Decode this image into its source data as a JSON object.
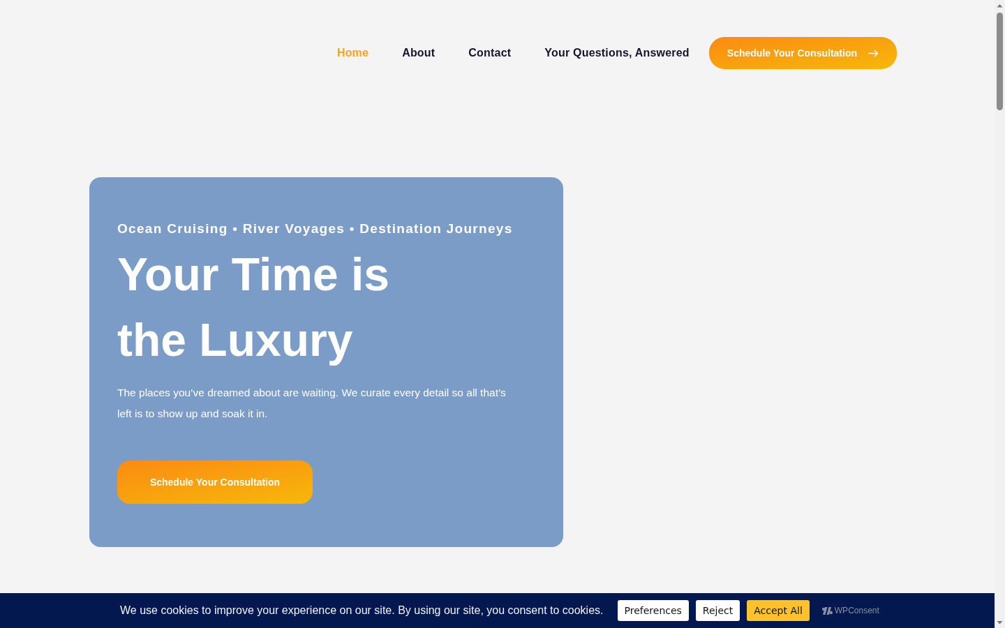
{
  "nav": {
    "links": [
      {
        "label": "Home",
        "selected": true
      },
      {
        "label": "About",
        "selected": false
      },
      {
        "label": "Contact",
        "selected": false
      },
      {
        "label": "Your Questions, Answered",
        "selected": false
      }
    ],
    "cta": {
      "label": "Schedule Your Consultation"
    }
  },
  "hero": {
    "eyebrow": "Ocean Cruising • River Voyages • Destination Journeys",
    "title": "Your Time is the Luxury",
    "text": "The places you’ve dreamed about are waiting. We curate every detail so all that’s left is to show up and soak it in.",
    "button": "Schedule Your Consultation"
  },
  "cookie_banner": {
    "message": "We use cookies to improve your experience on our site. By using our site, you consent to cookies.",
    "buttons": [
      {
        "label": "Preferences",
        "kind": "secondary"
      },
      {
        "label": "Reject",
        "kind": "secondary"
      },
      {
        "label": "Accept All",
        "kind": "primary"
      }
    ],
    "brand": "WPConsent"
  }
}
